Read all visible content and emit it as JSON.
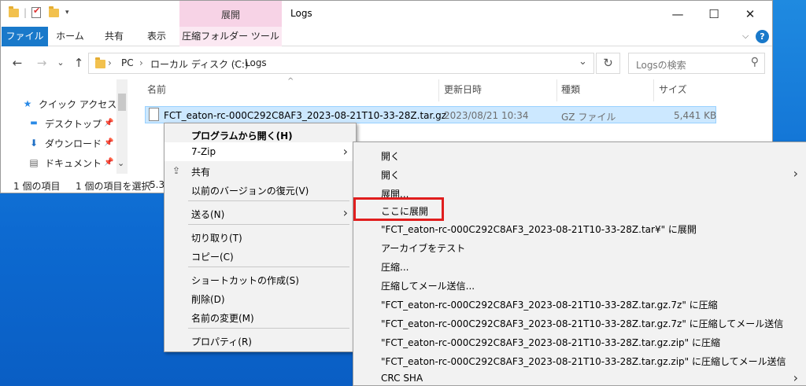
{
  "window": {
    "title": "Logs",
    "context_tab": "展開",
    "controls": {
      "minimize": "—",
      "maximize": "☐",
      "close": "✕"
    }
  },
  "ribbon": {
    "tabs": [
      "ファイル",
      "ホーム",
      "共有",
      "表示",
      "圧縮フォルダー ツール"
    ],
    "expand": "⌵",
    "help": "?"
  },
  "address": {
    "back": "←",
    "forward": "→",
    "recent": "⌄",
    "up": "↑",
    "sep": "›",
    "crumbs": [
      "PC",
      "ローカル ディスク (C:)",
      "Logs"
    ],
    "dropdown": "⌄",
    "refresh": "↻",
    "search_placeholder": "Logsの検索",
    "search_icon": "⚲"
  },
  "navpane": {
    "items": [
      {
        "label": "クイック アクセス",
        "icon": "star-icon",
        "glyph": "★"
      },
      {
        "label": "デスクトップ",
        "icon": "desktop-icon",
        "glyph": "▬"
      },
      {
        "label": "ダウンロード",
        "icon": "download-icon",
        "glyph": "⬇"
      },
      {
        "label": "ドキュメント",
        "icon": "document-icon",
        "glyph": "▤"
      }
    ],
    "pin": "📌",
    "scroll_down": "⌄"
  },
  "filelist": {
    "sort_indicator": "^",
    "columns": [
      "名前",
      "更新日時",
      "種類",
      "サイズ"
    ],
    "rows": [
      {
        "name": "FCT_eaton-rc-000C292C8AF3_2023-08-21T10-33-28Z.tar.gz",
        "modified": "2023/08/21 10:34",
        "type": "GZ ファイル",
        "size": "5,441 KB"
      }
    ]
  },
  "status": {
    "count": "1 個の項目",
    "selected": "1 個の項目を選択",
    "size_partial": "5.3"
  },
  "context_menu": {
    "items": [
      {
        "label": "プログラムから開く(H)",
        "bold": true
      },
      {
        "label": "7-Zip",
        "submenu": true,
        "hover": true
      },
      {
        "label": "共有",
        "icon": "share-icon"
      },
      {
        "label": "以前のバージョンの復元(V)"
      },
      {
        "label": "送る(N)",
        "submenu": true
      },
      {
        "label": "切り取り(T)"
      },
      {
        "label": "コピー(C)"
      },
      {
        "label": "ショートカットの作成(S)"
      },
      {
        "label": "削除(D)"
      },
      {
        "label": "名前の変更(M)"
      },
      {
        "label": "プロパティ(R)"
      }
    ]
  },
  "submenu_7zip": {
    "items": [
      {
        "label": "開く"
      },
      {
        "label": "開く",
        "submenu": true
      },
      {
        "label": "展開..."
      },
      {
        "label": "ここに展開",
        "highlighted": true
      },
      {
        "label": "\"FCT_eaton-rc-000C292C8AF3_2023-08-21T10-33-28Z.tar¥\" に展開"
      },
      {
        "label": "アーカイブをテスト"
      },
      {
        "label": "圧縮..."
      },
      {
        "label": "圧縮してメール送信..."
      },
      {
        "label": "\"FCT_eaton-rc-000C292C8AF3_2023-08-21T10-33-28Z.tar.gz.7z\" に圧縮"
      },
      {
        "label": "\"FCT_eaton-rc-000C292C8AF3_2023-08-21T10-33-28Z.tar.gz.7z\" に圧縮してメール送信"
      },
      {
        "label": "\"FCT_eaton-rc-000C292C8AF3_2023-08-21T10-33-28Z.tar.gz.zip\" に圧縮"
      },
      {
        "label": "\"FCT_eaton-rc-000C292C8AF3_2023-08-21T10-33-28Z.tar.gz.zip\" に圧縮してメール送信"
      },
      {
        "label": "CRC SHA",
        "submenu": true
      }
    ]
  },
  "glyphs": {
    "submenu_arrow": "›",
    "share": "⇪"
  },
  "colors": {
    "accent": "#1979ca",
    "context_tab": "#f7d3e6",
    "selection": "#cce8ff",
    "highlight_box": "#e01e1e"
  }
}
